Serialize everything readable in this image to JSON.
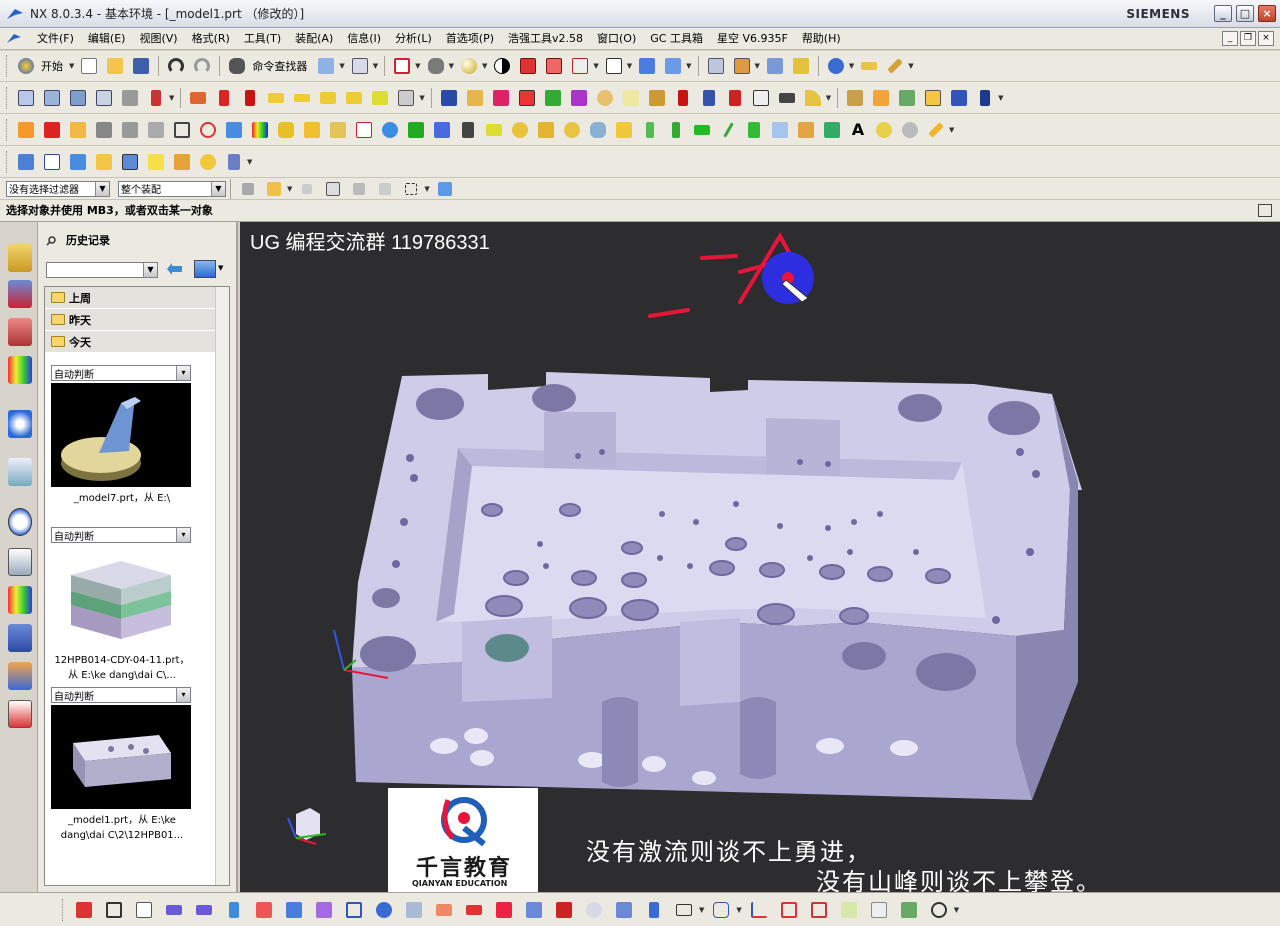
{
  "window": {
    "title": "NX 8.0.3.4 - 基本环境 - [_model1.prt （修改的）]",
    "brand": "SIEMENS",
    "controls": [
      "_",
      "□",
      "×"
    ]
  },
  "menubar": {
    "items": [
      "文件(F)",
      "编辑(E)",
      "视图(V)",
      "格式(R)",
      "工具(T)",
      "装配(A)",
      "信息(I)",
      "分析(L)",
      "首选项(P)",
      "浩强工具v2.58",
      "窗口(O)",
      "GC 工具箱",
      "星空 V6.935F",
      "帮助(H)"
    ]
  },
  "toolbar": {
    "start_label": "开始",
    "command_finder_label": "命令查找器"
  },
  "selection_bar": {
    "filter_value": "没有选择过滤器",
    "scope_value": "整个装配"
  },
  "prompt": {
    "text": "选择对象并使用 MB3，或者双击某一对象"
  },
  "history_panel": {
    "title": "历史记录",
    "groups": [
      "上周",
      "昨天",
      "今天"
    ],
    "entries": [
      {
        "mode": "自动判断",
        "caption": "_model7.prt，从 E:\\"
      },
      {
        "mode": "自动判断",
        "caption": "12HPB014-CDY-04-11.prt，从 E:\\ke dang\\dai C\\..."
      },
      {
        "mode": "自动判断",
        "caption": "_model1.prt，从 E:\\ke dang\\dai C\\2\\12HPB01..."
      }
    ]
  },
  "viewport": {
    "watermark": "UG 编程交流群 119786331",
    "logo_cn": "千言教育",
    "logo_en": "QIANYAN EDUCATION",
    "quote_line1": "没有激流则谈不上勇进，",
    "quote_line2": "没有山峰则谈不上攀登。",
    "colors": {
      "background": "#2d2d2f",
      "part": "#c9c6e6",
      "annotation": "#e8153a",
      "cursor_halo": "#2c2ee0"
    }
  }
}
